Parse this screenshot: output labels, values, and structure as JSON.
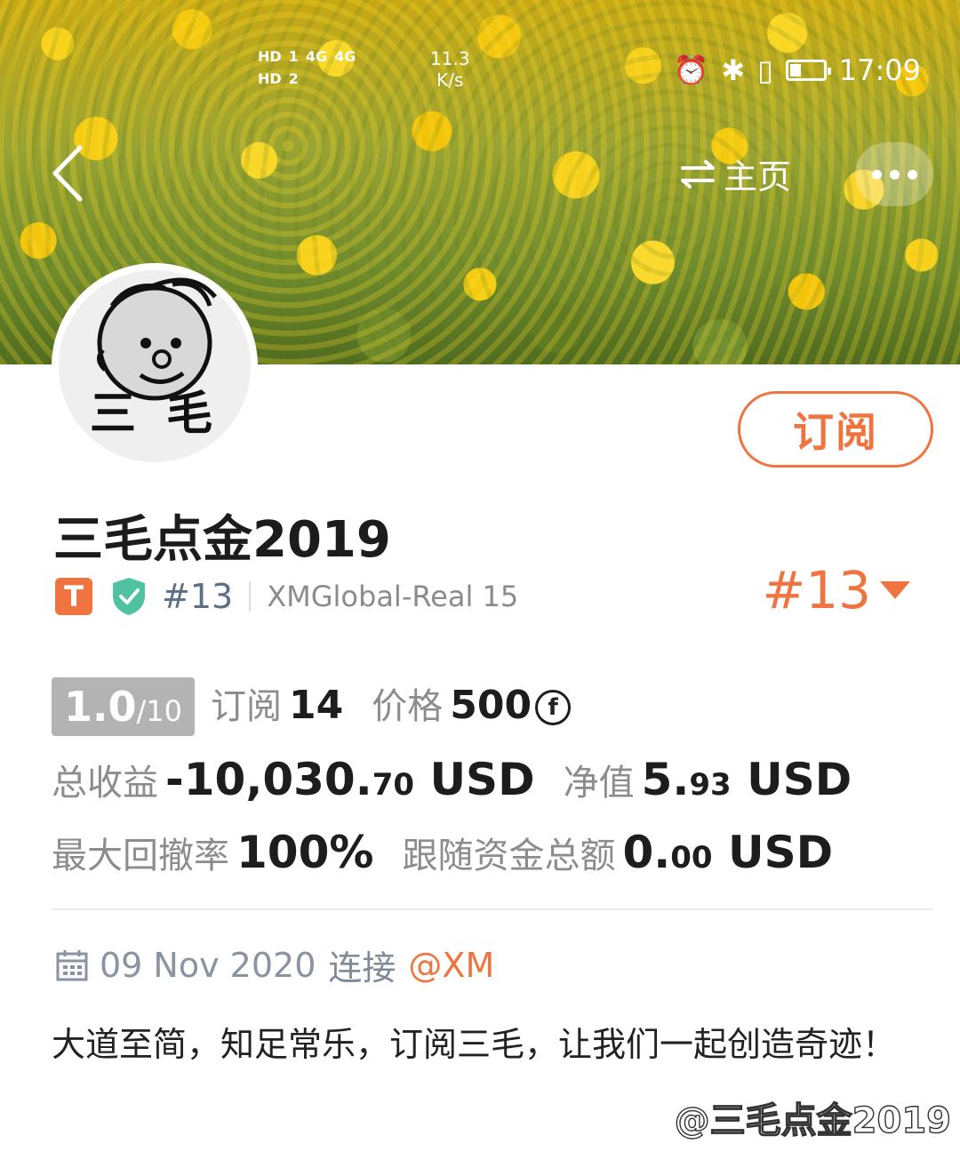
{
  "status_bar": {
    "sim1_label": "HD",
    "sim1_slot": "1",
    "sim2_label": "HD",
    "sim2_slot": "2",
    "network1": "4G",
    "network2": "4G",
    "speed_value": "11.3",
    "speed_unit": "K/s",
    "time": "17:09"
  },
  "nav": {
    "home_label": "主页",
    "home_icon": "swap-arrows-icon"
  },
  "profile": {
    "avatar_caption": "三 毛",
    "name": "三毛点金2019",
    "badge_letter": "T",
    "rank_small": "#13",
    "server": "XMGlobal-Real 15",
    "rank_big": "#13",
    "subscribe_label": "订阅"
  },
  "stats": {
    "score_main": "1.0",
    "score_max": "/10",
    "subscribers_label": "订阅",
    "subscribers_value": "14",
    "price_label": "价格",
    "price_value": "500",
    "price_symbol": "f",
    "total_profit_label": "总收益",
    "total_profit_int": "-10,030.",
    "total_profit_dec": "70",
    "total_profit_unit": "USD",
    "equity_label": "净值",
    "equity_int": "5.",
    "equity_dec": "93",
    "equity_unit": "USD",
    "drawdown_label": "最大回撤率",
    "drawdown_value": "100%",
    "follow_funds_label": "跟随资金总额",
    "follow_funds_int": "0.",
    "follow_funds_dec": "00",
    "follow_funds_unit": "USD"
  },
  "connection": {
    "date": "09 Nov 2020",
    "word": "连接",
    "broker": "@XM"
  },
  "bio": "大道至简，知足常乐，订阅三毛，让我们一起创造奇迹！",
  "watermark": "@三毛点金2019",
  "colors": {
    "accent": "#f0743f",
    "score_bg": "#b3b3b3",
    "shield": "#4fc3a1"
  }
}
